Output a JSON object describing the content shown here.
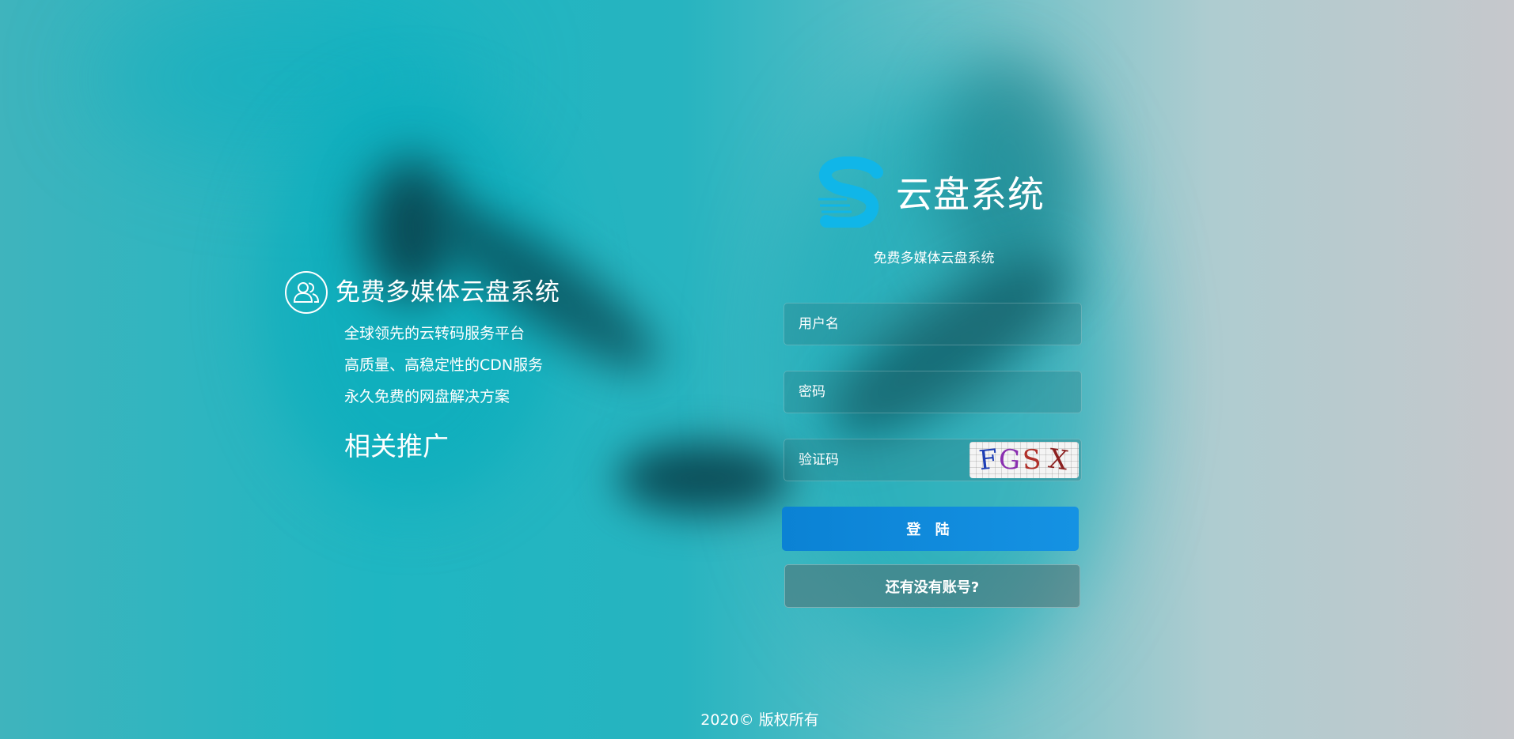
{
  "info": {
    "title": "免费多媒体云盘系统",
    "lines": [
      "全球领先的云转码服务平台",
      "高质量、高稳定性的CDN服务",
      "永久免费的网盘解决方案"
    ],
    "promo_title": "相关推广"
  },
  "brand": {
    "name": "云盘系统",
    "subtitle": "免费多媒体云盘系统",
    "logo_color": "#10b6e8"
  },
  "login_form": {
    "username_placeholder": "用户名",
    "password_placeholder": "密码",
    "captcha_placeholder": "验证码",
    "captcha_text": [
      "F",
      "G",
      "S",
      "X"
    ],
    "captcha_colors": [
      "#1e3fb5",
      "#8a2fb0",
      "#b0302a",
      "#8c2020"
    ],
    "login_label": "登 陆",
    "register_label": "还有没有账号?"
  },
  "footer": {
    "copyright": "2020© 版权所有"
  },
  "colors": {
    "primary_button": "#0b82d4",
    "text": "#ffffff"
  }
}
